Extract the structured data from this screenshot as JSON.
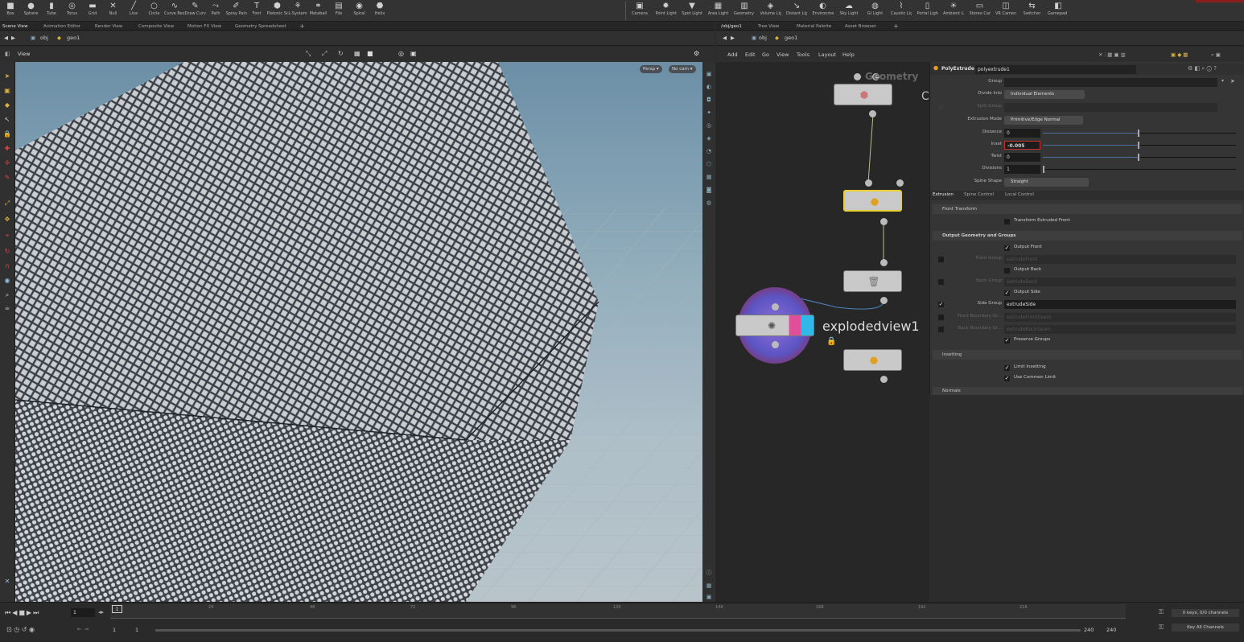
{
  "shelf": {
    "tools_left": [
      {
        "label": "Box",
        "icon": "■"
      },
      {
        "label": "Sphere",
        "icon": "●"
      },
      {
        "label": "Tube",
        "icon": "▮"
      },
      {
        "label": "Torus",
        "icon": "◎"
      },
      {
        "label": "Grid",
        "icon": "▬"
      },
      {
        "label": "Null",
        "icon": "✕"
      },
      {
        "label": "Line",
        "icon": "╱"
      },
      {
        "label": "Circle",
        "icon": "○"
      },
      {
        "label": "Curve Bezier",
        "icon": "∿"
      },
      {
        "label": "Draw Curve",
        "icon": "✎"
      },
      {
        "label": "Path",
        "icon": "⤳"
      },
      {
        "label": "Spray Paint",
        "icon": "✐"
      },
      {
        "label": "Font",
        "icon": "T"
      },
      {
        "label": "Platonic Solids",
        "icon": "⬢"
      },
      {
        "label": "L-System",
        "icon": "⚘"
      },
      {
        "label": "Metaball",
        "icon": "⚭"
      },
      {
        "label": "File",
        "icon": "▤"
      },
      {
        "label": "Spiral",
        "icon": "◉"
      },
      {
        "label": "Helix",
        "icon": "⬣"
      }
    ],
    "tools_right": [
      {
        "label": "Camera",
        "icon": "▣"
      },
      {
        "label": "Point Light",
        "icon": "✹"
      },
      {
        "label": "Spot Light",
        "icon": "▼"
      },
      {
        "label": "Area Light",
        "icon": "▦"
      },
      {
        "label": "Geometry Light",
        "icon": "▥"
      },
      {
        "label": "Volume Light",
        "icon": "◈"
      },
      {
        "label": "Distant Light",
        "icon": "↘"
      },
      {
        "label": "Environment Light",
        "icon": "◐"
      },
      {
        "label": "Sky Light",
        "icon": "☁"
      },
      {
        "label": "GI Light",
        "icon": "◍"
      },
      {
        "label": "Caustic Light",
        "icon": "⌇"
      },
      {
        "label": "Portal Light",
        "icon": "▯"
      },
      {
        "label": "Ambient Light",
        "icon": "☀"
      },
      {
        "label": "Stereo Camera",
        "icon": "▭"
      },
      {
        "label": "VR Camera",
        "icon": "◫"
      },
      {
        "label": "Switcher",
        "icon": "⇆"
      },
      {
        "label": "Gamepad Camera",
        "icon": "◧"
      }
    ]
  },
  "left_tabs": [
    "Scene View",
    "Animation Editor",
    "Render View",
    "Composite View",
    "Motion FX View",
    "Geometry Spreadsheet"
  ],
  "right_tabs": [
    "/obj/geo1",
    "Tree View",
    "Material Palette",
    "Asset Browser"
  ],
  "left_path": {
    "context": "obj",
    "node": "geo1"
  },
  "right_path": {
    "context": "obj",
    "node": "geo1"
  },
  "viewport": {
    "title": "View",
    "persp": "Persp ▾",
    "cam": "No cam ▾"
  },
  "network": {
    "menus": [
      "Add",
      "Edit",
      "Go",
      "View",
      "Tools",
      "Layout",
      "Help"
    ],
    "top_node_label": "Geometry",
    "top_node_char": "C",
    "exploded_label": "explodedview1"
  },
  "params": {
    "node_type": "PolyExtrude",
    "node_name": "polyextrude1",
    "group_label": "Group",
    "divide_into_label": "Divide Into",
    "divide_into_value": "Individual Elements",
    "split_group_label": "Split Group",
    "extrusion_mode_label": "Extrusion Mode",
    "extrusion_mode_value": "Primitive/Edge Normal",
    "distance_label": "Distance",
    "distance_value": "0",
    "inset_label": "Inset",
    "inset_value": "-0.005",
    "twist_label": "Twist",
    "twist_value": "0",
    "divisions_label": "Divisions",
    "divisions_value": "1",
    "spine_shape_label": "Spine Shape",
    "spine_shape_value": "Straight",
    "tabs": [
      "Extrusion",
      "Spine Control",
      "Local Control"
    ],
    "front_transform": "Front Transform",
    "transform_extruded_front": "Transform Extruded Front",
    "output_section": "Output Geometry and Groups",
    "output_front": "Output Front",
    "front_group_label": "Front Group",
    "front_group_value": "extrudeFront",
    "output_back": "Output Back",
    "back_group_label": "Back Group",
    "back_group_value": "extrudeBack",
    "output_side": "Output Side",
    "side_group_label": "Side Group",
    "side_group_value": "extrudeSide",
    "front_boundary_label": "Front Boundary Gr...",
    "front_boundary_value": "extrudeFrontSeam",
    "back_boundary_label": "Back Boundary Gr...",
    "back_boundary_value": "extrudeBackSeam",
    "preserve_groups": "Preserve Groups",
    "insetting_section": "Insetting",
    "limit_insetting": "Limit Insetting",
    "use_common_limit": "Use Common Limit",
    "normals_section": "Normals"
  },
  "timeline": {
    "frame": "1",
    "start": "1",
    "start2": "1",
    "end": "240",
    "end2": "240",
    "ticks": [
      "24",
      "48",
      "72",
      "96",
      "120",
      "144",
      "168",
      "192",
      "216"
    ],
    "marker": "1",
    "keys_info": "0 keys, 0/0 channels",
    "key_all": "Key All Channels"
  },
  "colors": {
    "accent": "#e8d030",
    "selection_outline": "#e8d030",
    "inset_field_border": "#c23030"
  }
}
